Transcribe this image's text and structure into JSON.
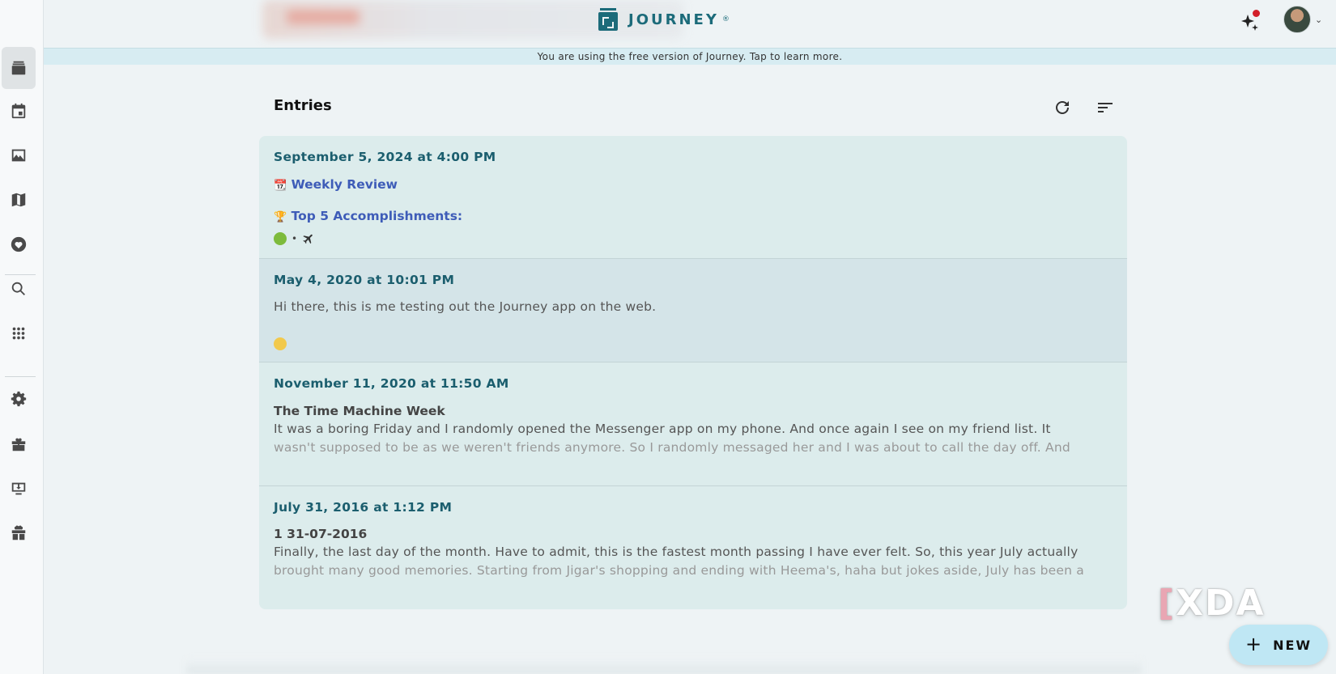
{
  "app": {
    "name": "JOURNEY",
    "reg": "®"
  },
  "banner": {
    "free_notice": "You are using the free version of Journey. Tap to learn more."
  },
  "sidebar": {
    "items": [
      {
        "icon": "journal-icon",
        "active": true
      },
      {
        "icon": "calendar-icon"
      },
      {
        "icon": "photos-icon"
      },
      {
        "icon": "map-icon"
      },
      {
        "icon": "heart-icon"
      },
      {
        "icon": "search-icon"
      },
      {
        "icon": "apps-icon"
      },
      {
        "icon": "gear-icon"
      },
      {
        "icon": "sale-icon"
      },
      {
        "icon": "download-icon"
      },
      {
        "icon": "gift-icon"
      }
    ]
  },
  "main": {
    "title": "Entries",
    "entries": [
      {
        "date": "September 5, 2024 at 4:00 PM",
        "line1_emoji": "📆",
        "line1": "Weekly Review",
        "line2_emoji": "🏆",
        "line2": "Top 5 Accomplishments:",
        "meta_sep": "•"
      },
      {
        "date": "May 4, 2020 at 10:01 PM",
        "text": "Hi there, this is me testing out the Journey app on the web."
      },
      {
        "date": "November 11, 2020 at 11:50 AM",
        "title": "The Time Machine Week",
        "text1": "It was a boring Friday and I randomly opened the Messenger app on my phone. And once again I see on my friend list. It",
        "text2": "wasn't supposed to be as we weren't friends anymore. So I randomly messaged her and I was about to call the day off. And"
      },
      {
        "date": "July 31, 2016 at 1:12 PM",
        "title": "1 31-07-2016",
        "text1": "Finally, the last day of the month. Have to admit, this is the fastest month passing I have ever felt. So, this year July actually",
        "text2": "brought many good memories. Starting from Jigar's shopping and ending with Heema's, haha but jokes aside, July has been a"
      }
    ]
  },
  "watermark": "XDA",
  "fab": {
    "plus": "+",
    "label": "NEW"
  },
  "colors": {
    "accent": "#1b5e6e",
    "link": "#3e5cb8",
    "notify": "#d21f2a",
    "fab": "#bfe7f4"
  }
}
